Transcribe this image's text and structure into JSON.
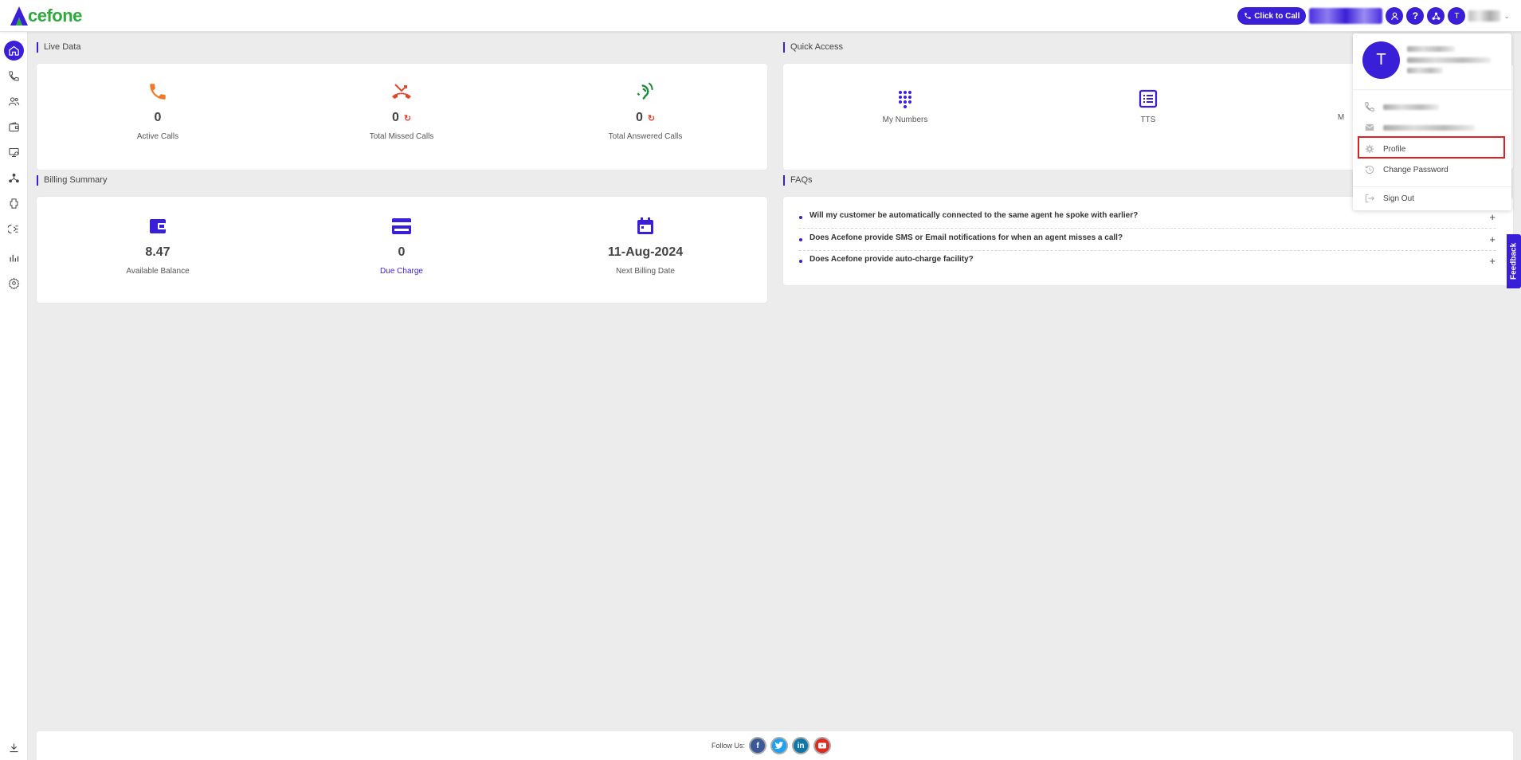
{
  "header": {
    "logo_a": "A",
    "logo_text": "cefone",
    "click_to_call": "Click to Call",
    "help": "?",
    "avatar_initial": "T"
  },
  "sidebar": {
    "items": [
      "home-icon",
      "phone-icon",
      "users-icon",
      "wallet-icon",
      "monitor-icon",
      "network-icon",
      "puzzle-icon",
      "support-icon",
      "chart-icon",
      "settings-icon",
      "download-icon"
    ]
  },
  "live_data": {
    "title": "Live Data",
    "stats": [
      {
        "value": "0",
        "label": "Active Calls"
      },
      {
        "value": "0",
        "label": "Total Missed Calls"
      },
      {
        "value": "0",
        "label": "Total Answered Calls"
      }
    ]
  },
  "quick_access": {
    "title": "Quick Access",
    "items": [
      {
        "label": "My Numbers"
      },
      {
        "label": "TTS"
      },
      {
        "label": "M"
      }
    ]
  },
  "billing": {
    "title": "Billing Summary",
    "stats": [
      {
        "value": "8.47",
        "label": "Available Balance"
      },
      {
        "value": "0",
        "label": "Due Charge"
      },
      {
        "value": "11-Aug-2024",
        "label": "Next Billing Date"
      }
    ]
  },
  "faqs": {
    "title": "FAQs",
    "items": [
      "Will my customer be automatically connected to the same agent he spoke with earlier?",
      "Does Acefone provide SMS or Email notifications for when an agent misses a call?",
      "Does Acefone provide auto-charge facility?"
    ],
    "expand": "+"
  },
  "dropdown": {
    "avatar_initial": "T",
    "profile": "Profile",
    "change_password": "Change Password",
    "sign_out": "Sign Out"
  },
  "feedback": "Feedback",
  "footer": {
    "follow_us": "Follow Us:",
    "facebook": "f",
    "linkedin": "in"
  },
  "colors": {
    "accent": "#3a1fd8",
    "brand_green": "#2eaa3c",
    "missed": "#e5432d",
    "answered": "#1a8a3a",
    "highlight": "#e02020"
  }
}
